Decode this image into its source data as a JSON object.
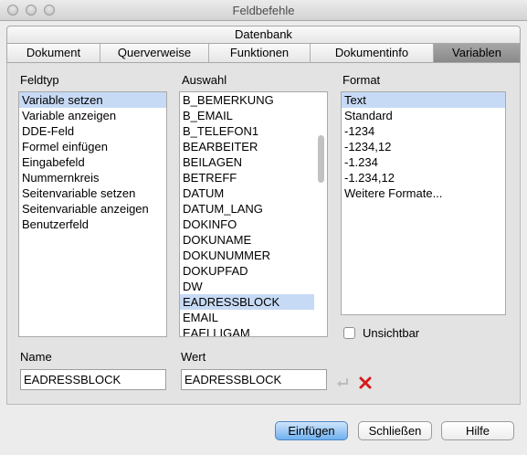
{
  "window": {
    "title": "Feldbefehle"
  },
  "tabs": {
    "top_row": [
      "Datenbank"
    ],
    "bottom_row": [
      "Dokument",
      "Querverweise",
      "Funktionen",
      "Dokumentinfo",
      "Variablen"
    ],
    "active": "Variablen"
  },
  "feldtyp": {
    "label": "Feldtyp",
    "items": [
      "Variable setzen",
      "Variable anzeigen",
      "DDE-Feld",
      "Formel einfügen",
      "Eingabefeld",
      "Nummernkreis",
      "Seitenvariable setzen",
      "Seitenvariable anzeigen",
      "Benutzerfeld"
    ],
    "selected": "Variable setzen"
  },
  "auswahl": {
    "label": "Auswahl",
    "items": [
      "B_BEMERKUNG",
      "B_EMAIL",
      "B_TELEFON1",
      "BEARBEITER",
      "BEILAGEN",
      "BETREFF",
      "DATUM",
      "DATUM_LANG",
      "DOKINFO",
      "DOKUNAME",
      "DOKUNUMMER",
      "DOKUPFAD",
      "DW",
      "EADRESSBLOCK",
      "EMAIL",
      "EAELLIGAM"
    ],
    "selected": "EADRESSBLOCK"
  },
  "format": {
    "label": "Format",
    "items": [
      "Text",
      "Standard",
      "-1234",
      "-1234,12",
      "-1.234",
      "-1.234,12",
      "Weitere Formate..."
    ],
    "selected": "Text"
  },
  "unsichtbar": {
    "label": "Unsichtbar",
    "checked": false
  },
  "name_field": {
    "label": "Name",
    "value": "EADRESSBLOCK"
  },
  "wert_field": {
    "label": "Wert",
    "value": "EADRESSBLOCK"
  },
  "buttons": {
    "insert": "Einfügen",
    "close": "Schließen",
    "help": "Hilfe"
  },
  "icons": [
    "apply-icon",
    "delete-icon"
  ]
}
